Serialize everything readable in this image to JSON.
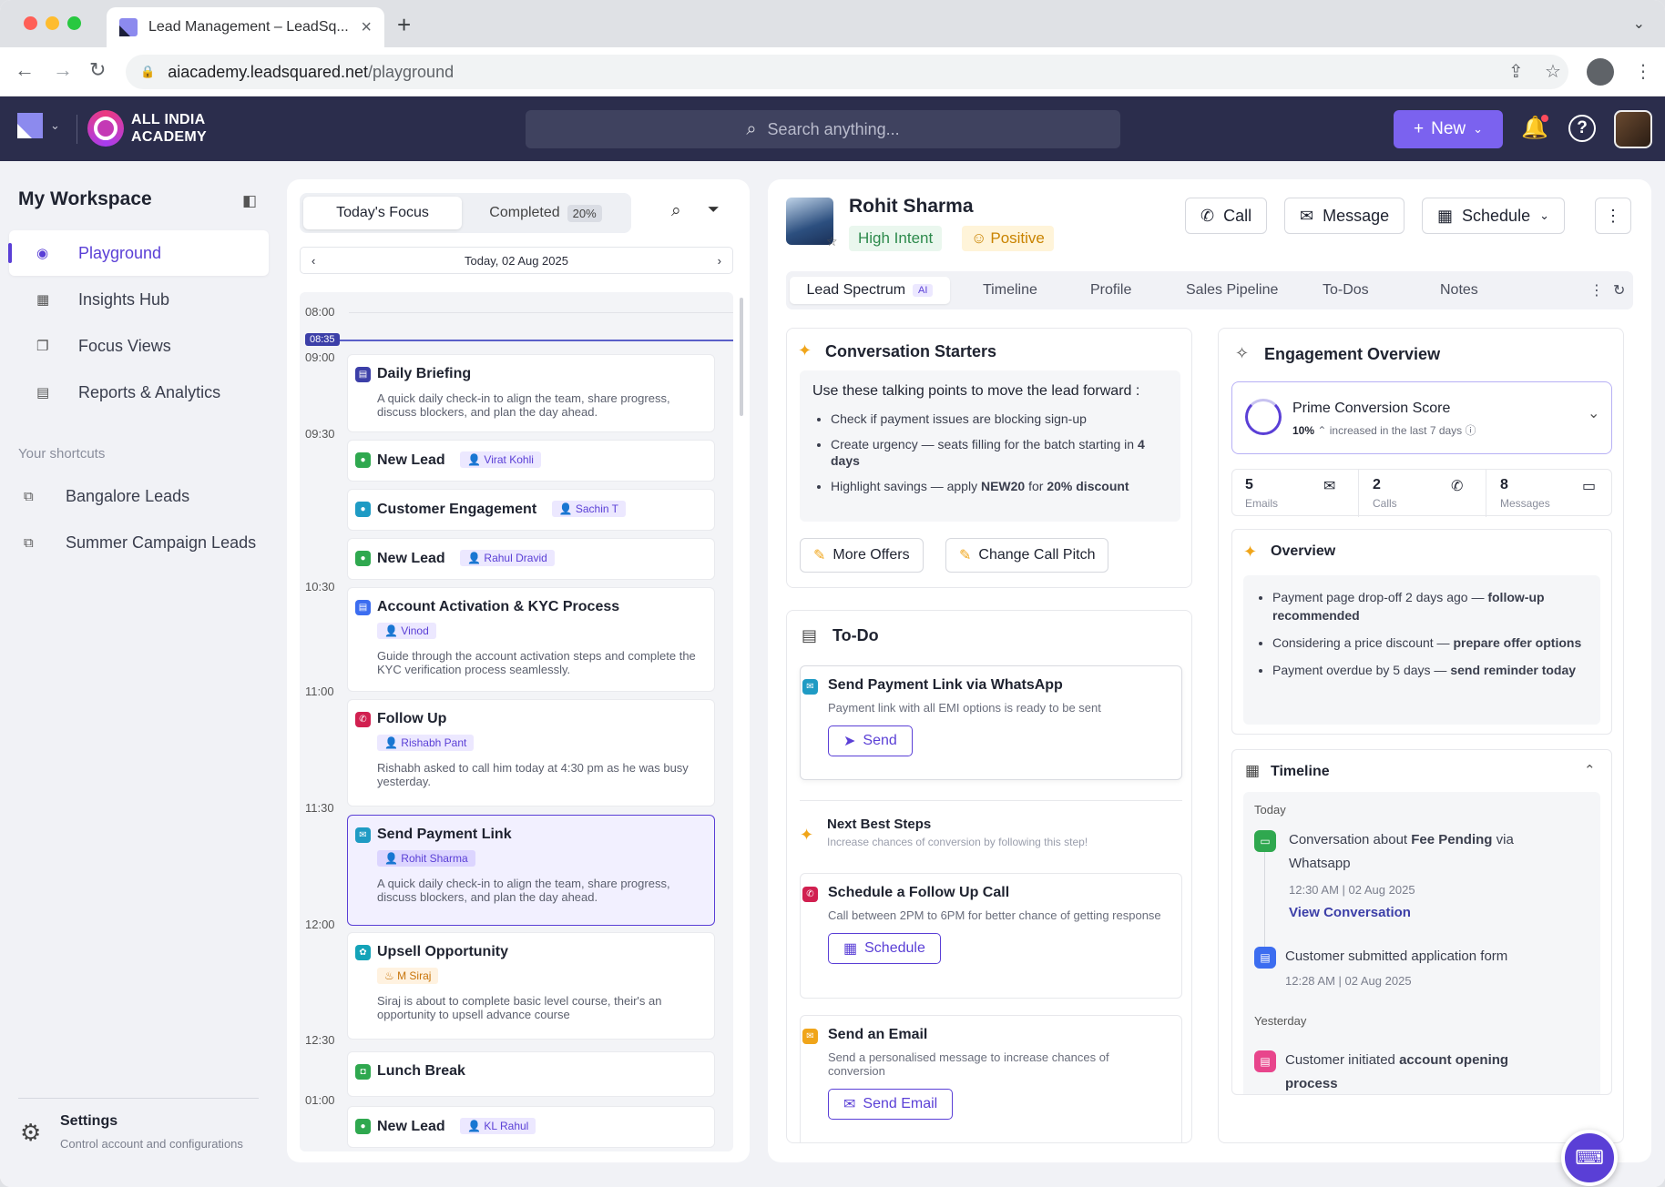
{
  "browser": {
    "tab_title": "Lead Management – LeadSq...",
    "url_domain": "aiacademy.leadsquared.net",
    "url_path": "/playground"
  },
  "appbar": {
    "brand_line1": "ALL INDIA",
    "brand_line2": "ACADEMY",
    "search_placeholder": "Search anything...",
    "new_label": "New"
  },
  "sidebar": {
    "title": "My Workspace",
    "items": [
      {
        "label": "Playground",
        "icon": "chat-bot-icon"
      },
      {
        "label": "Insights Hub",
        "icon": "grid-icon"
      },
      {
        "label": "Focus Views",
        "icon": "copy-icon"
      },
      {
        "label": "Reports & Analytics",
        "icon": "report-icon"
      }
    ],
    "shortcuts_title": "Your shortcuts",
    "shortcuts": [
      "Bangalore Leads",
      "Summer Campaign Leads"
    ],
    "settings_title": "Settings",
    "settings_sub": "Control account and configurations"
  },
  "agenda": {
    "tab_focus": "Today's Focus",
    "tab_completed": "Completed",
    "completed_pct": "20%",
    "date": "Today, 02 Aug 2025",
    "now": "08:35",
    "times": [
      "08:00",
      "09:00",
      "09:30",
      "10:30",
      "11:00",
      "11:30",
      "12:00",
      "12:30",
      "01:00"
    ],
    "events": [
      {
        "title": "Daily Briefing",
        "desc": "A quick daily check-in to align the team, share progress, discuss blockers, and plan the day ahead."
      },
      {
        "title": "New Lead",
        "person": "Virat Kohli"
      },
      {
        "title": "Customer Engagement",
        "person": "Sachin T"
      },
      {
        "title": "New Lead",
        "person": "Rahul Dravid"
      },
      {
        "title": "Account Activation & KYC Process",
        "person": "Vinod",
        "desc": "Guide through the account activation steps and complete the KYC verification process seamlessly."
      },
      {
        "title": "Follow Up",
        "person": "Rishabh Pant",
        "desc": "Rishabh asked to call him today at 4:30 pm as he was busy yesterday."
      },
      {
        "title": "Send Payment Link",
        "person": "Rohit Sharma",
        "desc": "A quick daily check-in to align the team, share progress, discuss blockers, and plan the day ahead."
      },
      {
        "title": "Upsell Opportunity",
        "person": "M Siraj",
        "desc": "Siraj is about to complete basic level course, their's an opportunity to upsell advance course"
      },
      {
        "title": "Lunch Break"
      },
      {
        "title": "New Lead",
        "person": "KL Rahul"
      }
    ]
  },
  "lead": {
    "name": "Rohit Sharma",
    "intent": "High Intent",
    "sentiment": "Positive",
    "actions": {
      "call": "Call",
      "message": "Message",
      "schedule": "Schedule"
    },
    "tabs": [
      "Lead Spectrum",
      "Timeline",
      "Profile",
      "Sales Pipeline",
      "To-Dos",
      "Notes"
    ],
    "ai_badge": "AI"
  },
  "conversation": {
    "title": "Conversation Starters",
    "lead": "Use these talking points to move the lead forward :",
    "points": [
      {
        "pre": "Check if payment issues are blocking sign-up"
      },
      {
        "pre": "Create urgency — seats filling for the batch starting in ",
        "b1": "4 days"
      },
      {
        "pre": "Highlight savings — apply ",
        "b1": "NEW20",
        "mid": " for ",
        "b2": "20% discount"
      }
    ],
    "more_offers": "More Offers",
    "change_pitch": "Change Call Pitch"
  },
  "todo": {
    "title": "To-Do",
    "primary": {
      "title": "Send Payment Link via WhatsApp",
      "desc": "Payment link with all EMI options is ready to be sent",
      "btn": "Send"
    },
    "next_title": "Next Best Steps",
    "next_sub": "Increase chances of conversion by following this step!",
    "steps": [
      {
        "title": "Schedule a Follow Up Call",
        "desc": "Call between 2PM to 6PM for better chance of getting response",
        "btn": "Schedule"
      },
      {
        "title": "Send an Email",
        "desc": "Send a personalised message to increase chances of conversion",
        "btn": "Send Email"
      }
    ]
  },
  "engagement": {
    "title": "Engagement Overview",
    "score_title": "Prime Conversion Score",
    "score_value": "10%",
    "score_note": "increased in the last 7 days",
    "stats": [
      {
        "n": "5",
        "l": "Emails"
      },
      {
        "n": "2",
        "l": "Calls"
      },
      {
        "n": "8",
        "l": "Messages"
      }
    ],
    "overview_title": "Overview",
    "overview": [
      {
        "pre": "Payment page drop-off 2 days ago — ",
        "b": "follow-up recommended"
      },
      {
        "pre": "Considering a price discount — ",
        "b": "prepare offer options"
      },
      {
        "pre": "Payment overdue by 5 days — ",
        "b": "send reminder today"
      }
    ],
    "timeline_title": "Timeline",
    "today": "Today",
    "yesterday": "Yesterday",
    "t1_pre": "Conversation about ",
    "t1_b": "Fee Pending",
    "t1_post": " via Whatsapp",
    "t1_time": "12:30 AM | 02 Aug 2025",
    "t1_link": "View Conversation",
    "t2": "Customer submitted application form",
    "t2_time": "12:28 AM | 02 Aug 2025",
    "t3_pre": "Customer initiated ",
    "t3_b": "account opening process"
  }
}
